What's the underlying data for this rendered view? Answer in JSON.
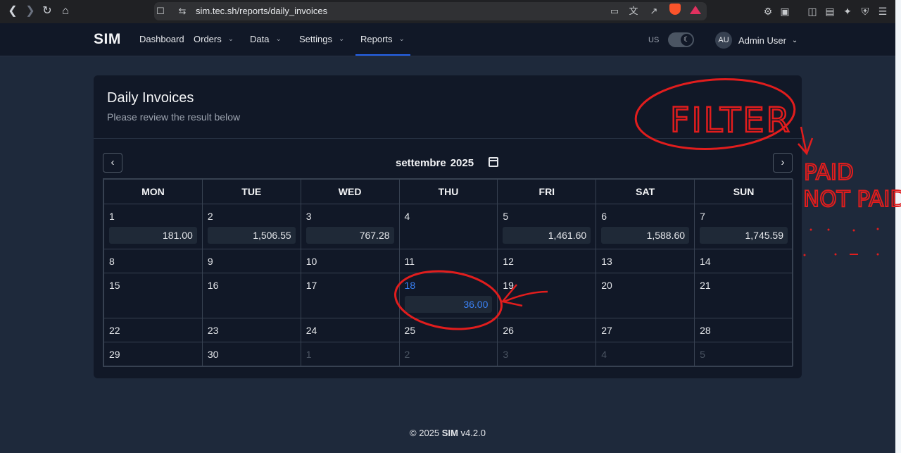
{
  "browser": {
    "url": "sim.tec.sh/reports/daily_invoices"
  },
  "navbar": {
    "brand": "SIM",
    "items": [
      {
        "label": "Dashboard",
        "has_menu": false
      },
      {
        "label": "Orders",
        "has_menu": true
      },
      {
        "label": "Data",
        "has_menu": true
      },
      {
        "label": "Settings",
        "has_menu": true
      },
      {
        "label": "Reports",
        "has_menu": true
      }
    ],
    "locale": "US",
    "avatar_initials": "AU",
    "user_name": "Admin User"
  },
  "card": {
    "title": "Daily Invoices",
    "subtitle": "Please review the result below"
  },
  "calendar": {
    "month": "settembre",
    "year": "2025",
    "weekdays": [
      "MON",
      "TUE",
      "WED",
      "THU",
      "FRI",
      "SAT",
      "SUN"
    ],
    "weeks": [
      [
        {
          "day": "1",
          "amount": "181.00"
        },
        {
          "day": "2",
          "amount": "1,506.55"
        },
        {
          "day": "3",
          "amount": "767.28"
        },
        {
          "day": "4",
          "amount": ""
        },
        {
          "day": "5",
          "amount": "1,461.60"
        },
        {
          "day": "6",
          "amount": "1,588.60"
        },
        {
          "day": "7",
          "amount": "1,745.59"
        }
      ],
      [
        {
          "day": "8",
          "amount": ""
        },
        {
          "day": "9",
          "amount": ""
        },
        {
          "day": "10",
          "amount": ""
        },
        {
          "day": "11",
          "amount": ""
        },
        {
          "day": "12",
          "amount": ""
        },
        {
          "day": "13",
          "amount": ""
        },
        {
          "day": "14",
          "amount": ""
        }
      ],
      [
        {
          "day": "15",
          "amount": ""
        },
        {
          "day": "16",
          "amount": ""
        },
        {
          "day": "17",
          "amount": ""
        },
        {
          "day": "18",
          "amount": "36.00",
          "today": true
        },
        {
          "day": "19",
          "amount": ""
        },
        {
          "day": "20",
          "amount": ""
        },
        {
          "day": "21",
          "amount": ""
        }
      ],
      [
        {
          "day": "22",
          "amount": ""
        },
        {
          "day": "23",
          "amount": ""
        },
        {
          "day": "24",
          "amount": ""
        },
        {
          "day": "25",
          "amount": ""
        },
        {
          "day": "26",
          "amount": ""
        },
        {
          "day": "27",
          "amount": ""
        },
        {
          "day": "28",
          "amount": ""
        }
      ],
      [
        {
          "day": "29",
          "amount": ""
        },
        {
          "day": "30",
          "amount": ""
        },
        {
          "day": "1",
          "amount": "",
          "muted": true
        },
        {
          "day": "2",
          "amount": "",
          "muted": true
        },
        {
          "day": "3",
          "amount": "",
          "muted": true
        },
        {
          "day": "4",
          "amount": "",
          "muted": true
        },
        {
          "day": "5",
          "amount": "",
          "muted": true
        }
      ]
    ]
  },
  "footer": {
    "copyright": "© 2025",
    "brand": "SIM",
    "version": "v4.2.0"
  },
  "annotations": {
    "filter": "FILTER",
    "paid": "PAID",
    "not_paid": "NOT PAID",
    "color": "#e11d1d"
  }
}
